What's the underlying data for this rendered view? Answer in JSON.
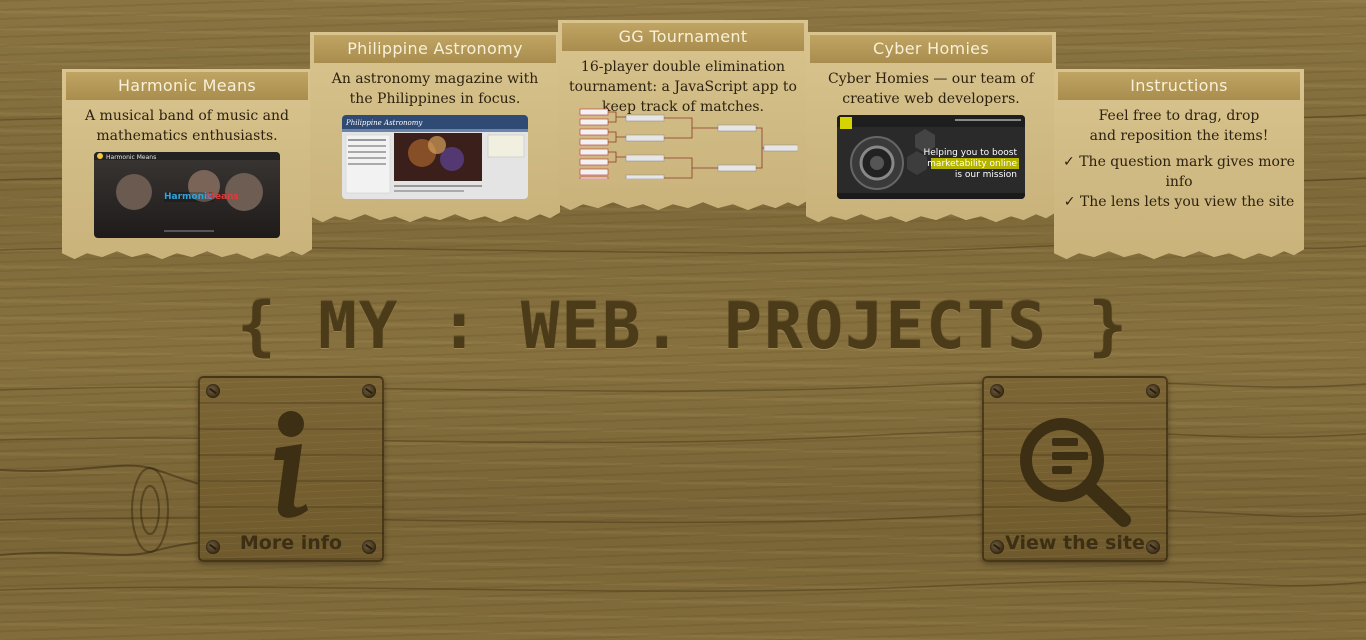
{
  "title": {
    "text": "{ MY : WEB. PROJECTS }"
  },
  "cards": [
    {
      "id": "harmonic",
      "title": "Harmonic Means",
      "description": "A musical band of music and mathematics enthusiasts.",
      "thumb_text": "Harmonic Means"
    },
    {
      "id": "astronomy",
      "title": "Philippine Astronomy",
      "description": "An astronomy magazine with the Philippines in focus.",
      "thumb_text": "Philippine Astronomy"
    },
    {
      "id": "gg",
      "title": "GG Tournament",
      "description": "16-player double elimination tournament: a JavaScript app to keep track of matches."
    },
    {
      "id": "cyber",
      "title": "Cyber Homies",
      "description": "Cyber Homies — our team of creative web developers.",
      "thumb_line1": "Helping you to boost",
      "thumb_line2": "marketability online",
      "thumb_line3": "is our mission"
    }
  ],
  "instructions": {
    "title": "Instructions",
    "text": "Feel free to drag, drop and reposition the items!",
    "items": [
      {
        "mark": "✓",
        "text": "The question mark gives more info"
      },
      {
        "mark": "✓",
        "text": "The lens lets you view the site"
      }
    ]
  },
  "buttons": {
    "more_info": {
      "label": "More info",
      "icon": "info-icon"
    },
    "view_site": {
      "label": "View the site",
      "icon": "magnifier-icon"
    }
  },
  "colors": {
    "wood": "#80693a",
    "paper": "#d4bf88",
    "card_header": "#b09650",
    "title_text": "#4c3b18"
  }
}
